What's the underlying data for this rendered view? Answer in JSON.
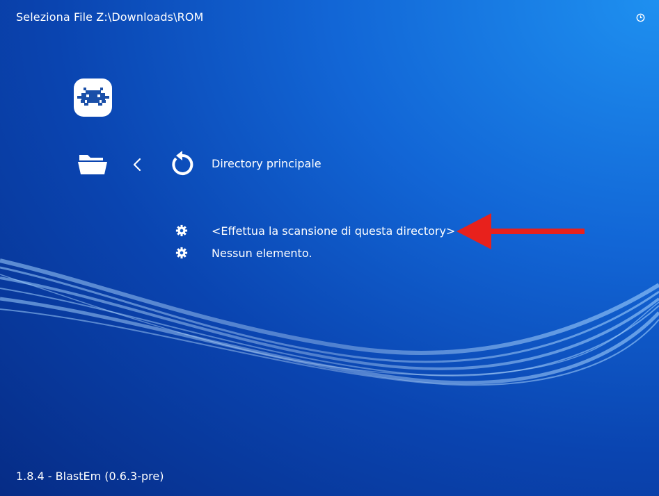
{
  "header": {
    "title": "Seleziona File Z:\\Downloads\\ROM",
    "clock_icon": "clock-icon"
  },
  "sidebar": {
    "logo_icon": "retroarch-invader-icon",
    "folder_icon": "folder-icon",
    "chevron_icon": "chevron-left-icon"
  },
  "main": {
    "parent_item": {
      "icon": "refresh-icon",
      "label": "Directory principale"
    },
    "items": [
      {
        "icon": "gear-icon",
        "label": "<Effettua la scansione di questa directory>"
      },
      {
        "icon": "gear-icon",
        "label": "Nessun elemento."
      }
    ]
  },
  "annotation": {
    "icon": "red-arrow-left-icon",
    "color": "#e8211c"
  },
  "footer": {
    "version": "1.8.4 - BlastEm (0.6.3-pre)"
  },
  "colors": {
    "background_top": "#1e90f0",
    "background_bottom": "#062c86",
    "text": "#ffffff"
  }
}
